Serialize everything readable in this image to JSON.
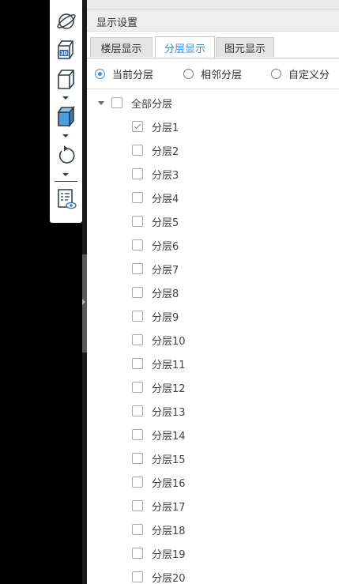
{
  "toolbar": {
    "items": [
      {
        "icon": "orbit-icon"
      },
      {
        "icon": "3d-view-icon",
        "label": "3D"
      },
      {
        "icon": "cube-outline-icon"
      },
      {
        "icon": "cube-filled-icon"
      },
      {
        "icon": "rotate-icon"
      },
      {
        "icon": "display-settings-icon"
      }
    ]
  },
  "panel": {
    "title": "显示设置",
    "tabs": [
      {
        "label": "楼层显示",
        "active": false
      },
      {
        "label": "分层显示",
        "active": true
      },
      {
        "label": "图元显示",
        "active": false
      }
    ],
    "radios": [
      {
        "label": "当前分层",
        "checked": true
      },
      {
        "label": "相邻分层",
        "checked": false
      },
      {
        "label": "自定义分",
        "checked": false
      }
    ],
    "tree": {
      "root": {
        "label": "全部分层",
        "checked": false,
        "expanded": true
      },
      "layers": [
        {
          "label": "分层1",
          "checked": true
        },
        {
          "label": "分层2",
          "checked": false
        },
        {
          "label": "分层3",
          "checked": false
        },
        {
          "label": "分层4",
          "checked": false
        },
        {
          "label": "分层5",
          "checked": false
        },
        {
          "label": "分层6",
          "checked": false
        },
        {
          "label": "分层7",
          "checked": false
        },
        {
          "label": "分层8",
          "checked": false
        },
        {
          "label": "分层9",
          "checked": false
        },
        {
          "label": "分层10",
          "checked": false
        },
        {
          "label": "分层11",
          "checked": false
        },
        {
          "label": "分层12",
          "checked": false
        },
        {
          "label": "分层13",
          "checked": false
        },
        {
          "label": "分层14",
          "checked": false
        },
        {
          "label": "分层15",
          "checked": false
        },
        {
          "label": "分层16",
          "checked": false
        },
        {
          "label": "分层17",
          "checked": false
        },
        {
          "label": "分层18",
          "checked": false
        },
        {
          "label": "分层19",
          "checked": false
        },
        {
          "label": "分层20",
          "checked": false
        }
      ]
    }
  },
  "colors": {
    "accent": "#3a8ee6",
    "icon": "#2f3b47",
    "icon_fill": "#4a9fe0"
  }
}
